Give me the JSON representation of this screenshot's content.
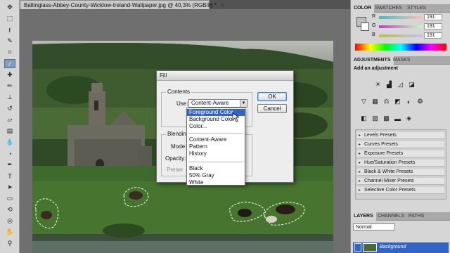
{
  "document": {
    "tab_title": "Baltinglass-Abbey-County-Wicklow-Ireland-Wallpaper.jpg @ 40,3% (RGB/8) *",
    "close_glyph": "×"
  },
  "tools": [
    "move-tool-icon",
    "marquee-tool-icon",
    "lasso-tool-icon",
    "quick-select-tool-icon",
    "crop-tool-icon",
    "eyedropper-tool-icon",
    "healing-brush-icon",
    "brush-tool-icon",
    "clone-stamp-icon",
    "history-brush-icon",
    "eraser-tool-icon",
    "gradient-tool-icon",
    "blur-tool-icon",
    "dodge-tool-icon",
    "pen-tool-icon",
    "type-tool-icon",
    "path-select-icon",
    "shape-tool-icon",
    "3d-rotate-icon",
    "3d-camera-icon",
    "hand-tool-icon",
    "zoom-tool-icon"
  ],
  "fill_dialog": {
    "title": "Fill",
    "contents_label": "Contents",
    "use_label": "Use:",
    "use_value": "Content-Aware",
    "blending_label": "Blending",
    "mode_label": "Mode:",
    "opacity_label": "Opacity:",
    "preserve_label": "Preser",
    "ok_label": "OK",
    "cancel_label": "Cancel",
    "options": [
      "Foreground Color",
      "Background Color",
      "Color...",
      "Content-Aware",
      "Pattern",
      "History",
      "Black",
      "50% Gray",
      "White"
    ],
    "highlighted_option": "Foreground Color"
  },
  "color_panel": {
    "tabs": [
      "COLOR",
      "SWATCHES",
      "STYLES"
    ],
    "channels": [
      {
        "name": "R",
        "value": "191"
      },
      {
        "name": "G",
        "value": "191"
      },
      {
        "name": "B",
        "value": "191"
      }
    ]
  },
  "adjustments_panel": {
    "tabs": [
      "ADJUSTMENTS",
      "MASKS"
    ],
    "heading": "Add an adjustment",
    "presets": [
      "Levels Presets",
      "Curves Presets",
      "Exposure Presets",
      "Hue/Saturation Presets",
      "Black & White Presets",
      "Channel Mixer Presets",
      "Selective Color Presets"
    ]
  },
  "layers_panel": {
    "tabs": [
      "LAYERS",
      "CHANNELS",
      "PATHS"
    ],
    "blend_mode": "Normal",
    "layer_name": "Background"
  },
  "colors": {
    "highlight": "#3264c8",
    "panel_bg": "#d6d6d6",
    "layer_selected": "#3264c8"
  }
}
